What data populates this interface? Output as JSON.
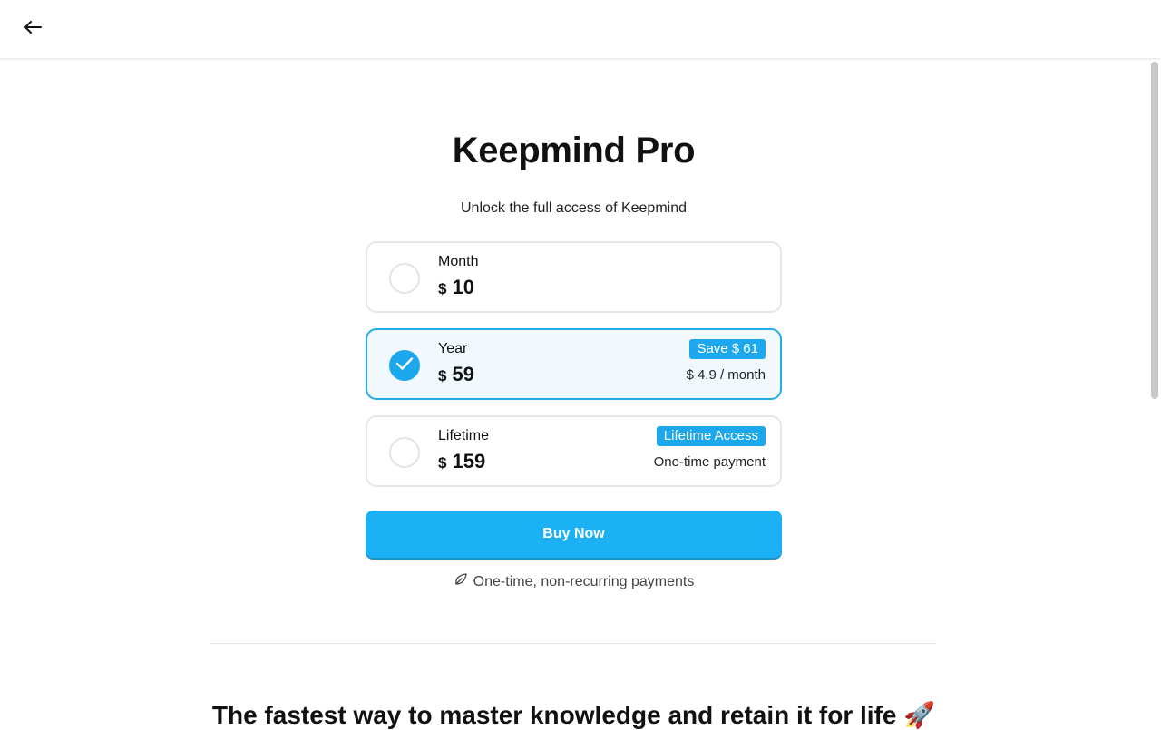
{
  "header": {
    "back_icon": "arrow-left-icon"
  },
  "hero": {
    "title": "Keepmind Pro",
    "subtitle": "Unlock the full access of Keepmind"
  },
  "plans": [
    {
      "name": "Month",
      "currency": "$",
      "amount": "10",
      "selected": false,
      "badge": "",
      "note": ""
    },
    {
      "name": "Year",
      "currency": "$",
      "amount": "59",
      "selected": true,
      "badge": "Save $ 61",
      "note": "$ 4.9 / month"
    },
    {
      "name": "Lifetime",
      "currency": "$",
      "amount": "159",
      "selected": false,
      "badge": "Lifetime Access",
      "note": "One-time payment"
    }
  ],
  "buy_button": {
    "label": "Buy Now"
  },
  "footnote": {
    "icon": "leaf-icon",
    "text": "One-time, non-recurring payments"
  },
  "headline": "The fastest way to master knowledge and retain it for life 🚀",
  "colors": {
    "accent": "#1da7ec",
    "selected_border": "#26abe9",
    "selected_bg": "#f1f8fe",
    "button": "#1cb0f4"
  }
}
